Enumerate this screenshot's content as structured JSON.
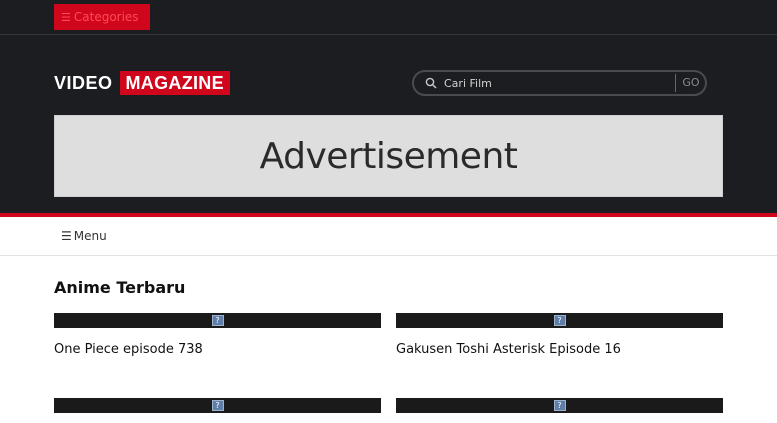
{
  "topbar": {
    "categories_label": "Categories"
  },
  "logo": {
    "part1": "VIDEO",
    "part2": "MAGAZINE"
  },
  "search": {
    "placeholder": "Cari Film",
    "go_label": "GO"
  },
  "ad": {
    "text": "Advertisement"
  },
  "menu": {
    "label": "Menu"
  },
  "section": {
    "title": "Anime Terbaru"
  },
  "items": [
    {
      "title": "One Piece episode 738"
    },
    {
      "title": "Gakusen Toshi Asterisk Episode 16"
    },
    {
      "title": ""
    },
    {
      "title": ""
    }
  ],
  "colors": {
    "brand_red": "#d0061c",
    "header_bg": "#1c1d21",
    "thumb_bg": "#1a1a1a"
  },
  "icons": {
    "categories": "bars-icon",
    "menu": "bars-icon",
    "search": "search-icon",
    "thumbnail": "broken-image-icon"
  }
}
